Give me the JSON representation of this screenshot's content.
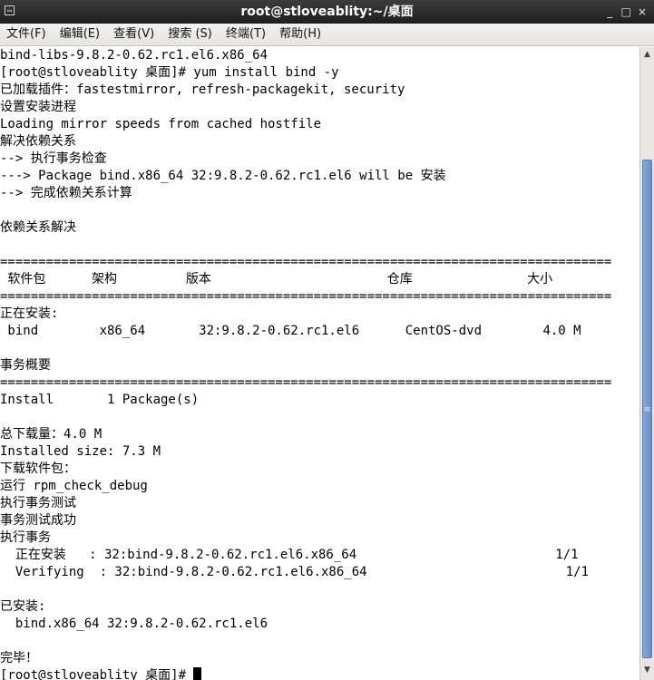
{
  "window": {
    "title": "root@stloveablity:~/桌面",
    "controls": {
      "minimize": "_",
      "maximize": "□",
      "close": "×"
    },
    "icon": "terminal-icon"
  },
  "menu": [
    "文件(F)",
    "编辑(E)",
    "查看(V)",
    "搜索 (S)",
    "终端(T)",
    "帮助(H)"
  ],
  "terminal": {
    "lines": [
      "bind-libs-9.8.2-0.62.rc1.el6.x86_64",
      "[root@stloveablity 桌面]# yum install bind -y",
      "已加载插件：fastestmirror, refresh-packagekit, security",
      "设置安装进程",
      "Loading mirror speeds from cached hostfile",
      "解决依赖关系",
      "--> 执行事务检查",
      "---> Package bind.x86_64 32:9.8.2-0.62.rc1.el6 will be 安装",
      "--> 完成依赖关系计算",
      "",
      "依赖关系解决",
      "",
      "================================================================================",
      " 软件包      架构         版本                       仓库               大小",
      "================================================================================",
      "正在安装:",
      " bind        x86_64       32:9.8.2-0.62.rc1.el6      CentOS-dvd        4.0 M",
      "",
      "事务概要",
      "================================================================================",
      "Install       1 Package(s)",
      "",
      "总下载量：4.0 M",
      "Installed size: 7.3 M",
      "下载软件包：",
      "运行 rpm_check_debug",
      "执行事务测试",
      "事务测试成功",
      "执行事务",
      "  正在安装   : 32:bind-9.8.2-0.62.rc1.el6.x86_64                          1/1",
      "  Verifying  : 32:bind-9.8.2-0.62.rc1.el6.x86_64                          1/1",
      "",
      "已安装:",
      "  bind.x86_64 32:9.8.2-0.62.rc1.el6",
      "",
      "完毕！",
      "[root@stloveablity 桌面]# "
    ]
  },
  "scrollbar": {
    "up_icon": "▲",
    "down_icon": "▼",
    "grip": "≡",
    "position": 0.93
  }
}
